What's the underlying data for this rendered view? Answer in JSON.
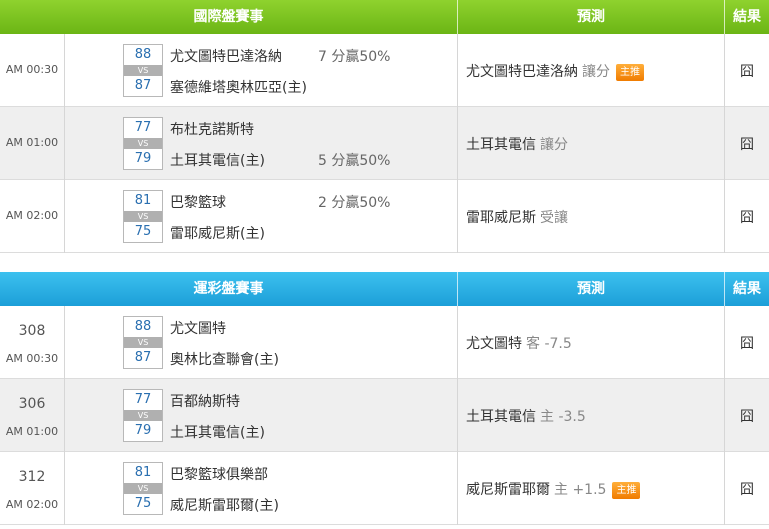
{
  "intl": {
    "header": {
      "match": "國際盤賽事",
      "prediction": "預測",
      "result": "結果"
    },
    "rows": [
      {
        "time": "AM 00:30",
        "score_home": "88",
        "vs": "VS",
        "score_away": "87",
        "team1": "尤文圖特巴達洛納",
        "team2": "塞德維塔奧林匹亞(主)",
        "odds_top": "7 分贏50%",
        "odds_bottom": "",
        "pick": "尤文圖特巴達洛納",
        "pick_type": "讓分",
        "badge": "主推",
        "result": "囧"
      },
      {
        "time": "AM 01:00",
        "score_home": "77",
        "vs": "VS",
        "score_away": "79",
        "team1": "布杜克諾斯特",
        "team2": "土耳其電信(主)",
        "odds_top": "",
        "odds_bottom": "5 分贏50%",
        "pick": "土耳其電信",
        "pick_type": "讓分",
        "badge": "",
        "result": "囧"
      },
      {
        "time": "AM 02:00",
        "score_home": "81",
        "vs": "VS",
        "score_away": "75",
        "team1": "巴黎籃球",
        "team2": "雷耶威尼斯(主)",
        "odds_top": "2 分贏50%",
        "odds_bottom": "",
        "pick": "雷耶威尼斯",
        "pick_type": "受讓",
        "badge": "",
        "result": "囧"
      }
    ]
  },
  "lottery": {
    "header": {
      "match": "運彩盤賽事",
      "prediction": "預測",
      "result": "結果"
    },
    "rows": [
      {
        "code": "308",
        "time": "AM 00:30",
        "score_home": "88",
        "vs": "VS",
        "score_away": "87",
        "team1": "尤文圖特",
        "team2": "奧林比查聯會(主)",
        "pick": "尤文圖特",
        "pick_type": "客 -7.5",
        "badge": "",
        "result": "囧"
      },
      {
        "code": "306",
        "time": "AM 01:00",
        "score_home": "77",
        "vs": "VS",
        "score_away": "79",
        "team1": "百都納斯特",
        "team2": "土耳其電信(主)",
        "pick": "土耳其電信",
        "pick_type": "主 -3.5",
        "badge": "",
        "result": "囧"
      },
      {
        "code": "312",
        "time": "AM 02:00",
        "score_home": "81",
        "vs": "VS",
        "score_away": "75",
        "team1": "巴黎籃球俱樂部",
        "team2": "威尼斯雷耶爾(主)",
        "pick": "威尼斯雷耶爾",
        "pick_type": "主 +1.5",
        "badge": "主推",
        "result": "囧"
      }
    ]
  },
  "colors": {
    "intl_header": "#7cc41f",
    "lottery_header": "#2ab0e6",
    "score_text": "#2a6fb0",
    "badge": "#f39200"
  }
}
